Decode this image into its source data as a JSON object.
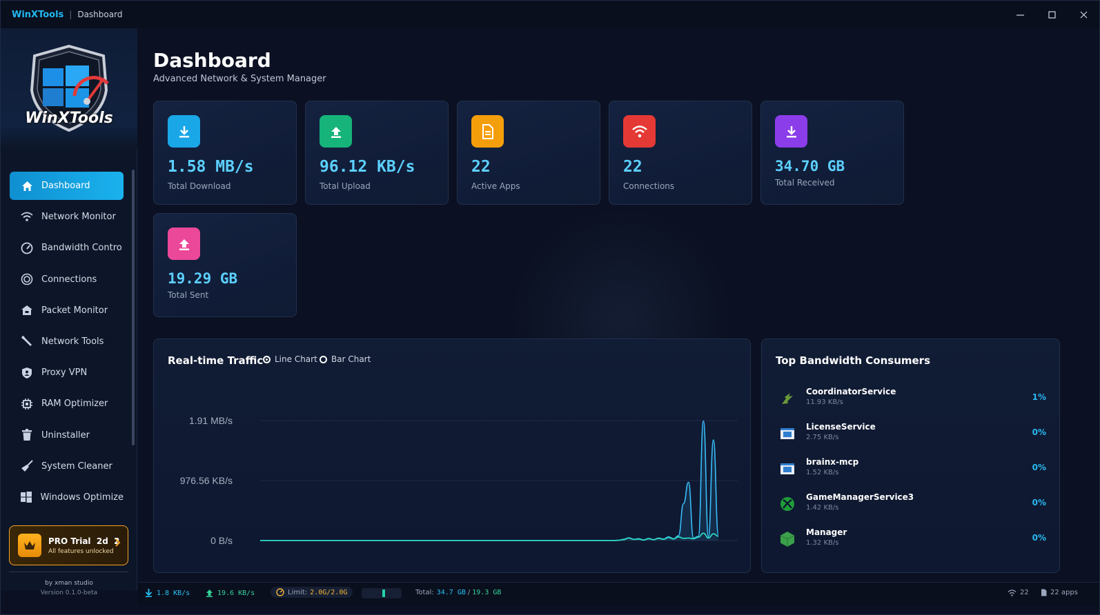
{
  "titlebar": {
    "app_name": "WinXTools",
    "separator": "|",
    "crumb": "Dashboard"
  },
  "sidebar": {
    "logo_text": "WinXTools",
    "items": [
      {
        "label": "Dashboard",
        "icon": "home-icon",
        "active": true
      },
      {
        "label": "Network Monitor",
        "icon": "wifi-icon"
      },
      {
        "label": "Bandwidth Contro",
        "icon": "speedometer-icon"
      },
      {
        "label": "Connections",
        "icon": "connections-icon"
      },
      {
        "label": "Packet Monitor",
        "icon": "packet-icon"
      },
      {
        "label": "Network Tools",
        "icon": "wrench-icon"
      },
      {
        "label": "Proxy VPN",
        "icon": "shield-icon"
      },
      {
        "label": "RAM Optimizer",
        "icon": "chip-icon"
      },
      {
        "label": "Uninstaller",
        "icon": "trash-icon"
      },
      {
        "label": "System Cleaner",
        "icon": "broom-icon"
      },
      {
        "label": "Windows Optimize",
        "icon": "windows-icon"
      }
    ],
    "pro": {
      "title": "PRO Trial  2d  2",
      "subtitle": "All features unlocked"
    },
    "credits": {
      "by": "by xman studio",
      "version": "Version 0.1.0-beta"
    }
  },
  "main": {
    "title": "Dashboard",
    "subtitle": "Advanced Network & System Manager",
    "stats": [
      {
        "value": "1.58 MB/s",
        "label": "Total Download",
        "icon": "download-icon",
        "color": "#1aa7e8"
      },
      {
        "value": "96.12 KB/s",
        "label": "Total Upload",
        "icon": "upload-icon",
        "color": "#16b47a"
      },
      {
        "value": "22",
        "label": "Active Apps",
        "icon": "file-icon",
        "color": "#f59e0b"
      },
      {
        "value": "22",
        "label": "Connections",
        "icon": "wifi-icon",
        "color": "#e53935"
      },
      {
        "value": "34.70 GB",
        "label": "Total Received",
        "icon": "download-icon",
        "color": "#8b3dea"
      },
      {
        "value": "19.29 GB",
        "label": "Total Sent",
        "icon": "upload-icon",
        "color": "#ec4899"
      }
    ]
  },
  "traffic": {
    "title": "Real-time Traffic",
    "modes": [
      {
        "label": "Line Chart",
        "selected": true
      },
      {
        "label": "Bar Chart",
        "selected": false
      }
    ]
  },
  "chart_data": {
    "type": "line",
    "title": "Real-time Traffic",
    "y_ticks": [
      "1.91 MB/s",
      "976.56 KB/s",
      "0 B/s"
    ],
    "ylim_kbps": [
      0,
      1955.84
    ],
    "grid": true,
    "series": [
      {
        "color": "#38bdf8",
        "values": [
          0,
          0,
          0,
          0,
          0,
          0,
          0,
          0,
          0,
          0,
          0,
          0,
          0,
          0,
          0,
          0,
          0,
          0,
          0,
          0,
          0,
          0,
          0,
          0,
          0,
          0,
          0,
          0,
          0,
          0,
          0,
          0,
          0,
          0,
          0,
          0,
          0,
          0,
          0,
          0,
          0,
          0,
          0,
          0,
          0,
          0,
          0,
          0,
          0,
          0,
          0,
          0,
          0,
          0,
          0,
          0,
          0,
          0,
          0,
          0,
          0,
          0,
          0,
          0,
          0,
          0,
          0,
          0,
          0,
          0,
          0,
          0,
          5,
          20,
          45,
          20,
          30,
          10,
          35,
          15,
          40,
          25,
          60,
          30,
          80,
          600,
          950,
          40,
          70,
          1950,
          60,
          1640,
          90
        ]
      },
      {
        "color": "#2dd4bf",
        "values": [
          0,
          0,
          0,
          0,
          0,
          0,
          0,
          0,
          0,
          0,
          0,
          0,
          0,
          0,
          0,
          0,
          0,
          0,
          0,
          0,
          0,
          0,
          0,
          0,
          0,
          0,
          0,
          0,
          0,
          0,
          0,
          0,
          0,
          0,
          0,
          0,
          0,
          0,
          0,
          0,
          0,
          0,
          0,
          0,
          0,
          0,
          0,
          0,
          0,
          0,
          0,
          0,
          0,
          0,
          0,
          0,
          0,
          0,
          0,
          0,
          0,
          0,
          0,
          0,
          0,
          0,
          0,
          0,
          0,
          0,
          0,
          0,
          4,
          15,
          40,
          18,
          25,
          8,
          30,
          12,
          35,
          20,
          50,
          25,
          60,
          35,
          40,
          30,
          55,
          120,
          40,
          110,
          70
        ]
      }
    ]
  },
  "consumers": {
    "title": "Top Bandwidth Consumers",
    "items": [
      {
        "name": "CoordinatorService",
        "rate": "11.93 KB/s",
        "pct": "1%",
        "icon": "app-icon",
        "color": "#4a7a2a"
      },
      {
        "name": "LicenseService",
        "rate": "2.75 KB/s",
        "pct": "0%",
        "icon": "window-icon",
        "color": "#2f7fd0"
      },
      {
        "name": "brainx-mcp",
        "rate": "1.52 KB/s",
        "pct": "0%",
        "icon": "window-icon",
        "color": "#2f7fd0"
      },
      {
        "name": "GameManagerService3",
        "rate": "1.42 KB/s",
        "pct": "0%",
        "icon": "xbox-icon",
        "color": "#1f9d3a"
      },
      {
        "name": "Manager",
        "rate": "1.32 KB/s",
        "pct": "0%",
        "icon": "cube-icon",
        "color": "#3aa04a"
      }
    ]
  },
  "statusbar": {
    "download": "1.8 KB/s",
    "upload": "19.6 KB/s",
    "limit_label": "Limit:",
    "limit_value": "2.0G/2.0G",
    "total_label": "Total:",
    "total_received": "34.7 GB",
    "total_sep": "/",
    "total_sent": "19.3 GB",
    "connections": "22",
    "apps": "22 apps"
  }
}
